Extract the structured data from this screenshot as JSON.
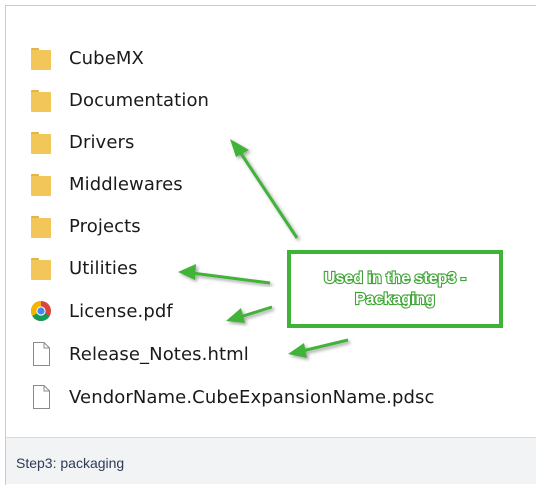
{
  "files": [
    {
      "name": "CubeMX",
      "icon": "folder-icon"
    },
    {
      "name": "Documentation",
      "icon": "folder-icon"
    },
    {
      "name": "Drivers",
      "icon": "folder-icon"
    },
    {
      "name": "Middlewares",
      "icon": "folder-icon"
    },
    {
      "name": "Projects",
      "icon": "folder-icon"
    },
    {
      "name": "Utilities",
      "icon": "folder-icon"
    },
    {
      "name": "License.pdf",
      "icon": "chrome-pdf-icon"
    },
    {
      "name": "Release_Notes.html",
      "icon": "document-icon"
    },
    {
      "name": "VendorName.CubeExpansionName.pdsc",
      "icon": "document-icon"
    }
  ],
  "annotation": {
    "line1": "Used in the step3 -",
    "line2": "Packaging"
  },
  "caption": "Step3: packaging",
  "colors": {
    "folder": "#f3c65a",
    "annotation_green": "#3fb337",
    "caption_bg": "#f2f3f5"
  }
}
